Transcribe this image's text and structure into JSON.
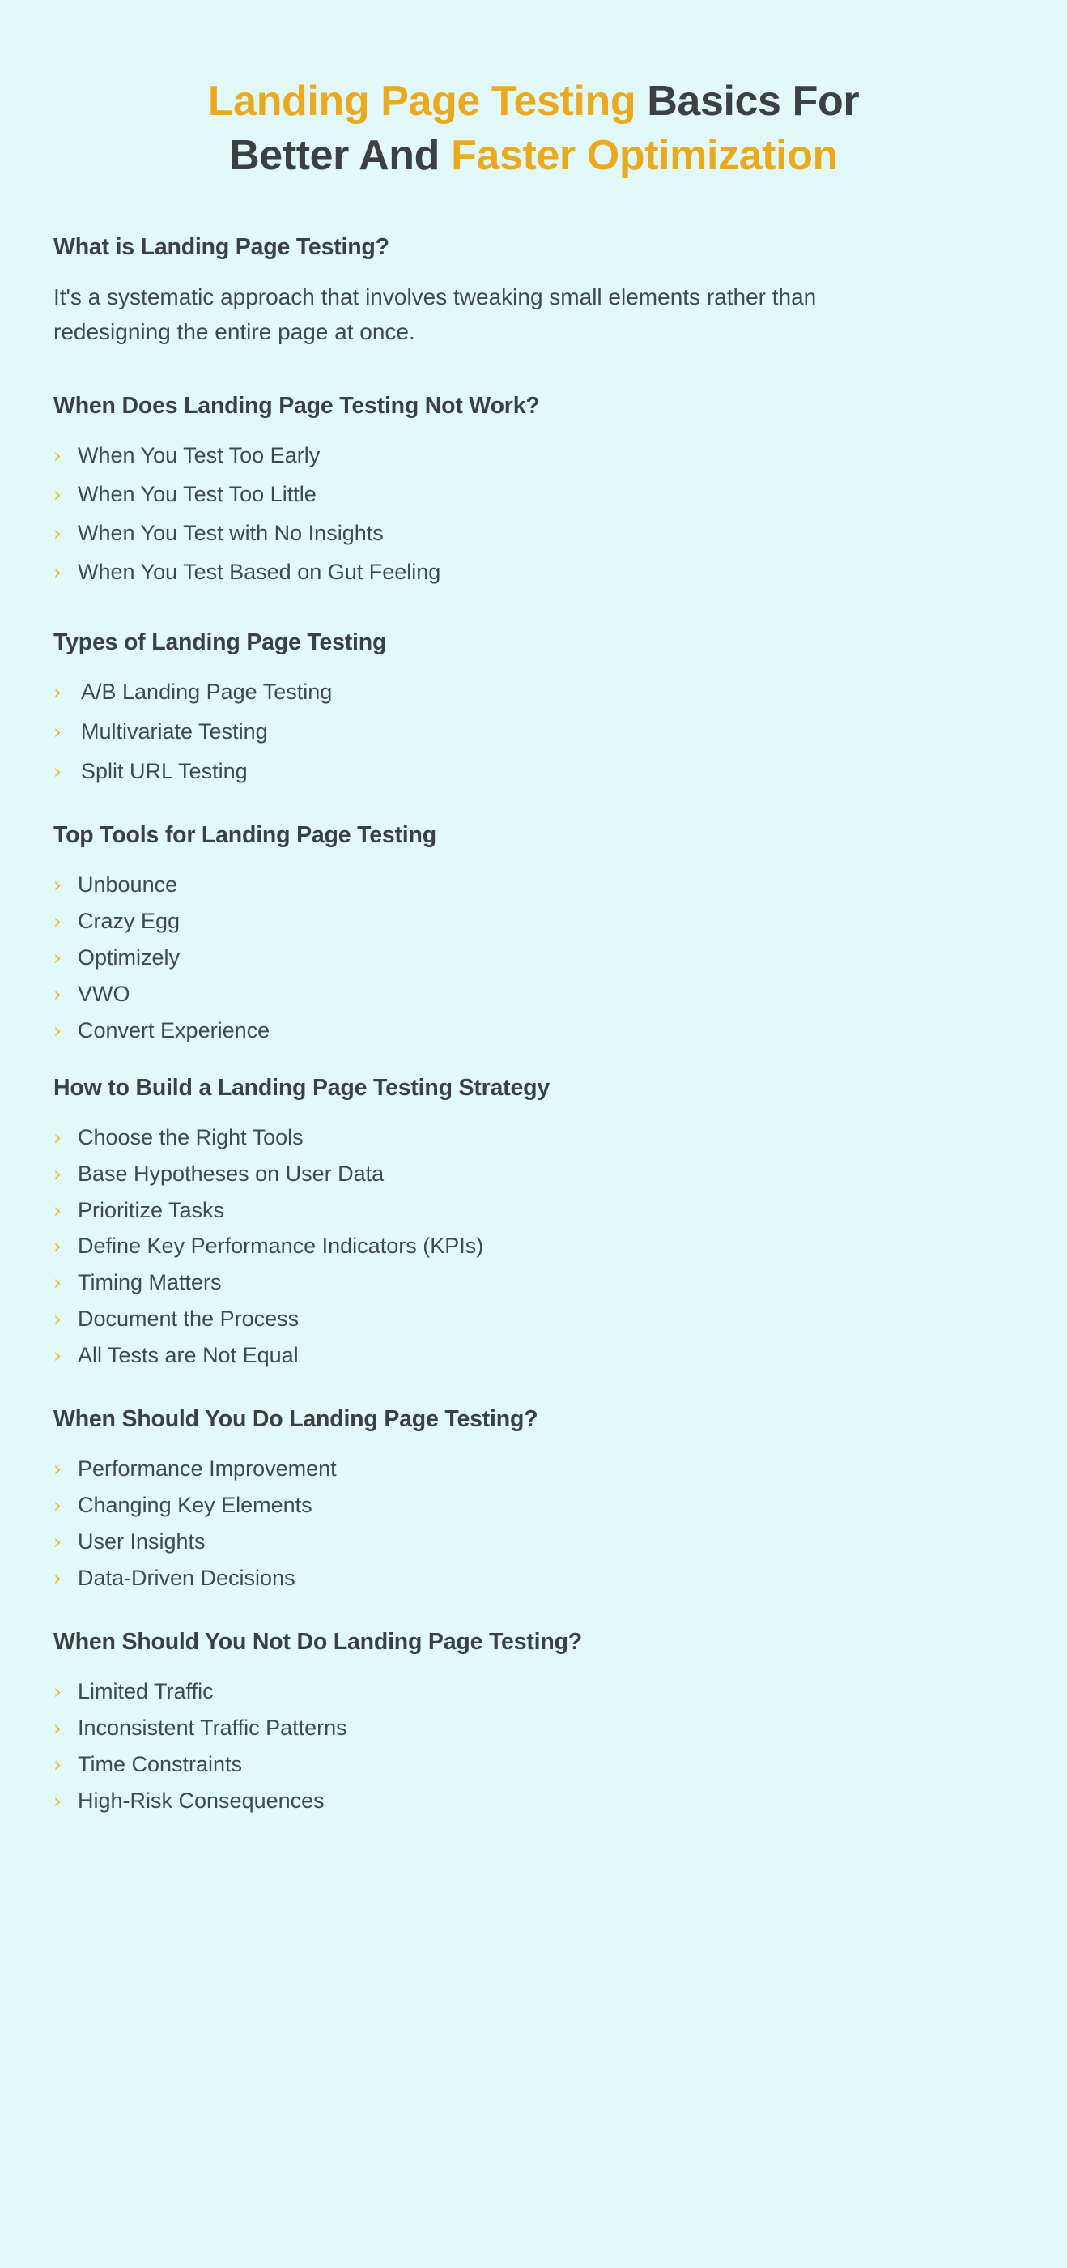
{
  "title": {
    "line1_highlight": "Landing Page Testing",
    "line1_rest": " Basics For",
    "line2_rest": "Better And ",
    "line2_highlight": "Faster Optimization"
  },
  "colors": {
    "background": "#e2f9f9",
    "accent": "#eaa91f",
    "bullet": "#f0b429",
    "heading": "#3c4043",
    "body": "#3f4a4d"
  },
  "icons": {
    "bullet_chevron": "›"
  },
  "sections": [
    {
      "heading": "What is Landing Page Testing?",
      "paragraph": "It's a systematic approach that involves tweaking small elements rather than redesigning the entire page at once.",
      "items": []
    },
    {
      "heading": "When Does Landing Page Testing Not Work?",
      "items": [
        "When You Test Too Early",
        "When You Test Too Little",
        "When You Test with No Insights",
        "When You Test Based on Gut Feeling"
      ]
    },
    {
      "heading": "Types of Landing Page Testing",
      "items": [
        "A/B Landing Page Testing",
        "Multivariate Testing",
        "Split URL Testing"
      ]
    },
    {
      "heading": "Top Tools for Landing Page Testing",
      "items": [
        "Unbounce",
        "Crazy Egg",
        "Optimizely",
        "VWO",
        "Convert Experience"
      ]
    },
    {
      "heading": "How to Build a Landing Page Testing Strategy",
      "items": [
        "Choose the Right Tools",
        "Base Hypotheses on User Data",
        "Prioritize Tasks",
        "Define Key Performance Indicators (KPIs)",
        "Timing Matters",
        "Document the Process",
        "All Tests are Not Equal"
      ]
    },
    {
      "heading": "When Should You Do Landing Page Testing?",
      "items": [
        "Performance Improvement",
        "Changing Key Elements",
        "User Insights",
        "Data-Driven Decisions"
      ]
    },
    {
      "heading": "When Should You Not Do Landing Page Testing?",
      "items": [
        "Limited Traffic",
        "Inconsistent Traffic Patterns",
        "Time Constraints",
        "High-Risk Consequences"
      ]
    }
  ]
}
